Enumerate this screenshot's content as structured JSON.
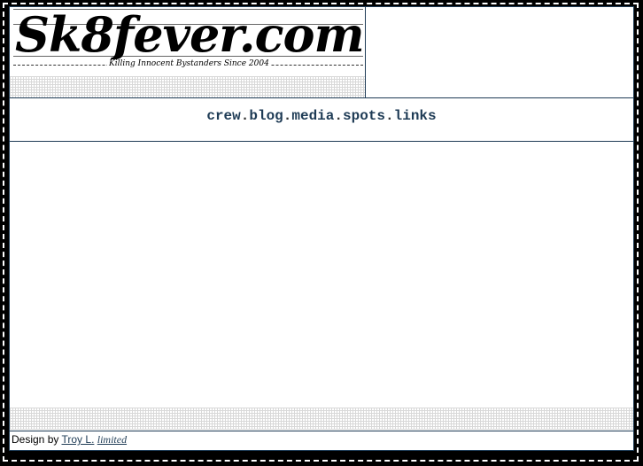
{
  "site": {
    "logo_text": "Sk8fever.com",
    "tagline": "Killing Innocent Bystanders Since 2004"
  },
  "nav": {
    "items": [
      "crew",
      "blog",
      "media",
      "spots",
      "links"
    ],
    "separator": "."
  },
  "footer": {
    "prefix": "Design by",
    "designer": "Troy L.",
    "limited": "limited"
  },
  "colors": {
    "accent": "#1e3b55",
    "background": "#000000",
    "page": "#ffffff"
  }
}
